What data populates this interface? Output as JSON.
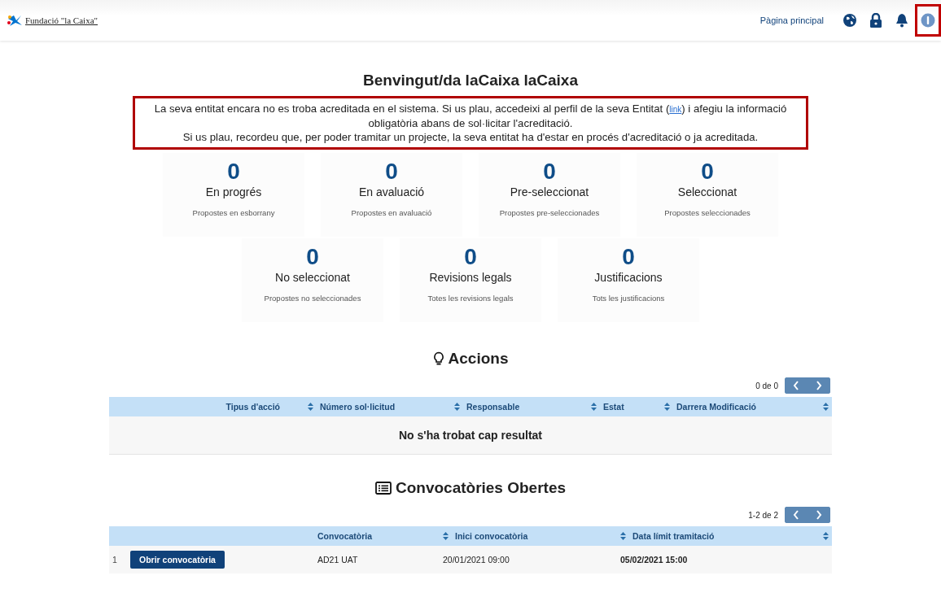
{
  "header": {
    "logo_text": "Fundació \"la Caixa\"",
    "nav_link": "Pàgina principal",
    "icons": [
      {
        "kind": "globe",
        "highlighted": false
      },
      {
        "kind": "lock",
        "highlighted": false
      },
      {
        "kind": "bell",
        "highlighted": false
      },
      {
        "kind": "info",
        "highlighted": true
      }
    ]
  },
  "title": "Benvingut/da laCaixa laCaixa",
  "notice": {
    "line1_before": "La seva entitat encara no es troba acreditada en el sistema. Si us plau, accedeixi al perfil de la seva Entitat (",
    "link": "link",
    "line1_after": ") i afegiu la informació obligatòria abans de sol·licitar l'acreditació.",
    "line2": "Si us plau, recordeu que, per poder tramitar un projecte, la seva entitat ha d'estar en procés d'acreditació o ja acreditada."
  },
  "stats": [
    {
      "count": "0",
      "label": "En progrés",
      "caption": "Propostes en esborrany"
    },
    {
      "count": "0",
      "label": "En avaluació",
      "caption": "Propostes en avaluació"
    },
    {
      "count": "0",
      "label": "Pre-seleccionat",
      "caption": "Propostes pre-seleccionades"
    },
    {
      "count": "0",
      "label": "Seleccionat",
      "caption": "Propostes seleccionades"
    },
    {
      "count": "0",
      "label": "No seleccionat",
      "caption": "Propostes no seleccionades"
    },
    {
      "count": "0",
      "label": "Revisions legals",
      "caption": "Totes les revisions legals"
    },
    {
      "count": "0",
      "label": "Justificacions",
      "caption": "Tots les justificacions"
    }
  ],
  "actions": {
    "title": "Accions",
    "pager": "0 de 0",
    "columns": [
      "Tipus d'acció",
      "Número sol·licitud",
      "Responsable",
      "Estat",
      "Darrera Modificació"
    ],
    "empty": "No s'ha trobat cap resultat"
  },
  "calls": {
    "title": "Convocatòries Obertes",
    "pager": "1-2 de 2",
    "columns": [
      "Convocatòria",
      "Inici convocatòria",
      "Data límit tramitació"
    ],
    "rows": [
      {
        "index": "1",
        "button": "Obrir convocatòria",
        "name": "AD21 UAT",
        "start": "20/01/2021 09:00",
        "deadline": "05/02/2021 15:00"
      }
    ]
  }
}
